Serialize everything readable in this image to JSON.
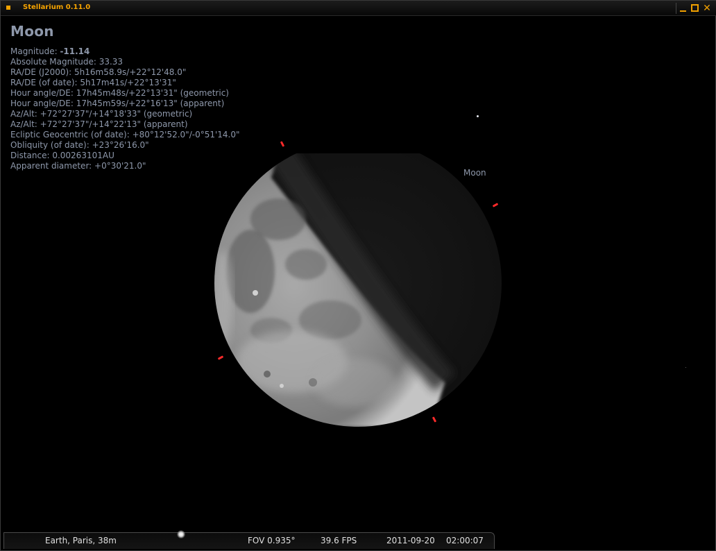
{
  "window": {
    "title": "Stellarium 0.11.0",
    "close_glyph": "✕"
  },
  "info": {
    "name": "Moon",
    "magnitude_label": "Magnitude: ",
    "magnitude_value": "-11.14",
    "lines": [
      "Absolute Magnitude: 33.33",
      "RA/DE (J2000): 5h16m58.9s/+22°12'48.0\"",
      "RA/DE (of date): 5h17m41s/+22°13'31\"",
      "Hour angle/DE: 17h45m48s/+22°13'31\" (geometric)",
      "Hour angle/DE: 17h45m59s/+22°16'13\" (apparent)",
      "Az/Alt: +72°27'37\"/+14°18'33\" (geometric)",
      "Az/Alt: +72°27'37\"/+14°22'13\" (apparent)",
      "Ecliptic Geocentric (of date): +80°12'52.0\"/-0°51'14.0\"",
      "Obliquity (of date): +23°26'16.0\"",
      "Distance: 0.00263101AU",
      "Apparent diameter: +0°30'21.0\""
    ]
  },
  "sky": {
    "object_label": "Moon",
    "illumination_fraction": 0.35
  },
  "status": {
    "location": "Earth, Paris, 38m",
    "fov": "FOV 0.935°",
    "fps": "39.6 FPS",
    "date": "2011-09-20",
    "time": "02:00:07"
  },
  "colors": {
    "title_accent": "#f5a300",
    "info_text": "#8e98ab",
    "selection_marker": "#ff2a2a",
    "background": "#000000"
  },
  "icons": [
    "app-menu-icon",
    "minimize-icon",
    "maximize-icon",
    "close-icon"
  ]
}
